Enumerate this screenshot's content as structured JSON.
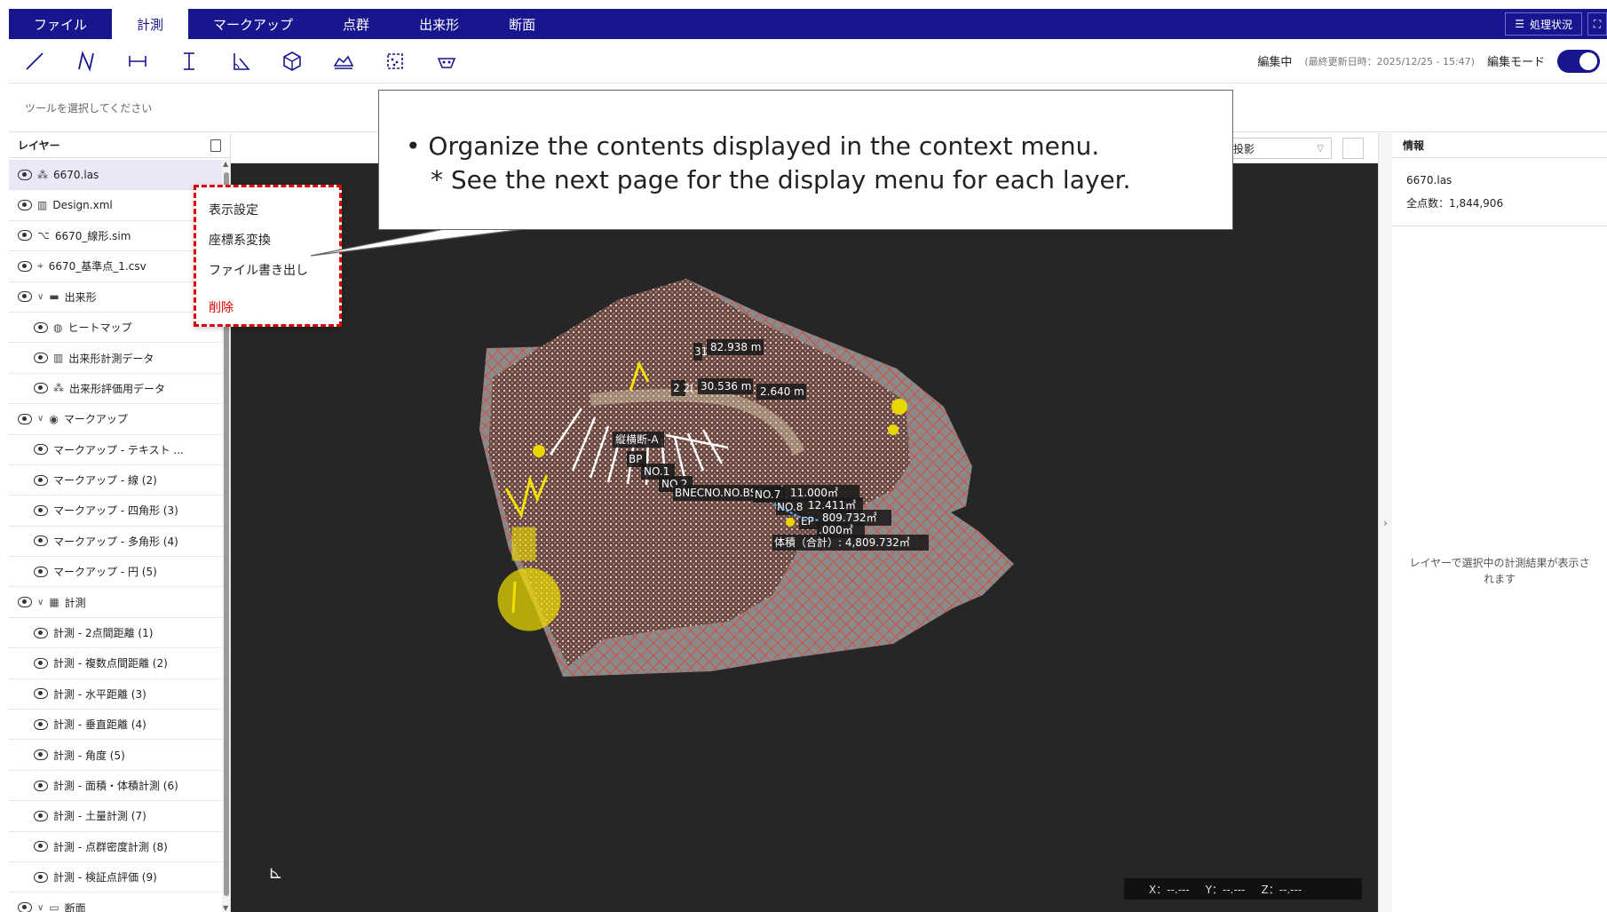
{
  "menubar": {
    "items": [
      {
        "label": "ファイル",
        "active": false
      },
      {
        "label": "計測",
        "active": true
      },
      {
        "label": "マークアップ",
        "active": false
      },
      {
        "label": "点群",
        "active": false
      },
      {
        "label": "出来形",
        "active": false
      },
      {
        "label": "断面",
        "active": false
      }
    ],
    "status_label": "処理状況"
  },
  "toolbar": {
    "tools": [
      "line-tool-icon",
      "polyline-tool-icon",
      "horizontal-distance-icon",
      "vertical-distance-icon",
      "angle-tool-icon",
      "volume-tool-icon",
      "earthwork-tool-icon",
      "density-tool-icon",
      "inspection-tool-icon"
    ],
    "edit_status": "編集中",
    "last_updated": "(最終更新日時：2025/12/25 - 15:47)",
    "edit_mode_label": "編集モード"
  },
  "hint": "ツールを選択してください",
  "layers_panel": {
    "title": "レイヤー",
    "items": [
      {
        "label": "6670.las",
        "icon": "⁂",
        "indent": false,
        "group": false,
        "selected": true
      },
      {
        "label": "Design.xml",
        "icon": "▥",
        "indent": false,
        "group": false,
        "selected": false
      },
      {
        "label": "6670_線形.sim",
        "icon": "⌥",
        "indent": false,
        "group": false,
        "selected": false
      },
      {
        "label": "6670_基準点_1.csv",
        "icon": "⌖",
        "indent": false,
        "group": false,
        "selected": false
      },
      {
        "label": "出来形",
        "icon": "▬",
        "indent": false,
        "group": true,
        "selected": false
      },
      {
        "label": "ヒートマップ",
        "icon": "◍",
        "indent": true,
        "group": false,
        "selected": false
      },
      {
        "label": "出来形計測データ",
        "icon": "▥",
        "indent": true,
        "group": false,
        "selected": false
      },
      {
        "label": "出来形評価用データ",
        "icon": "⁂",
        "indent": true,
        "group": false,
        "selected": false
      },
      {
        "label": "マークアップ",
        "icon": "◉",
        "indent": false,
        "group": true,
        "selected": false
      },
      {
        "label": "マークアップ - テキスト ...",
        "icon": "",
        "indent": true,
        "group": false,
        "selected": false
      },
      {
        "label": "マークアップ - 線 (2)",
        "icon": "",
        "indent": true,
        "group": false,
        "selected": false
      },
      {
        "label": "マークアップ - 四角形 (3)",
        "icon": "",
        "indent": true,
        "group": false,
        "selected": false
      },
      {
        "label": "マークアップ - 多角形 (4)",
        "icon": "",
        "indent": true,
        "group": false,
        "selected": false
      },
      {
        "label": "マークアップ - 円 (5)",
        "icon": "",
        "indent": true,
        "group": false,
        "selected": false
      },
      {
        "label": "計測",
        "icon": "▦",
        "indent": false,
        "group": true,
        "selected": false
      },
      {
        "label": "計測 - 2点間距離 (1)",
        "icon": "",
        "indent": true,
        "group": false,
        "selected": false
      },
      {
        "label": "計測 - 複数点間距離 (2)",
        "icon": "",
        "indent": true,
        "group": false,
        "selected": false
      },
      {
        "label": "計測 - 水平距離 (3)",
        "icon": "",
        "indent": true,
        "group": false,
        "selected": false
      },
      {
        "label": "計測 - 垂直距離 (4)",
        "icon": "",
        "indent": true,
        "group": false,
        "selected": false
      },
      {
        "label": "計測 - 角度 (5)",
        "icon": "",
        "indent": true,
        "group": false,
        "selected": false
      },
      {
        "label": "計測 - 面積・体積計測 (6)",
        "icon": "",
        "indent": true,
        "group": false,
        "selected": false
      },
      {
        "label": "計測 - 土量計測 (7)",
        "icon": "",
        "indent": true,
        "group": false,
        "selected": false
      },
      {
        "label": "計測 - 点群密度計測 (8)",
        "icon": "",
        "indent": true,
        "group": false,
        "selected": false
      },
      {
        "label": "計測 - 検証点評価 (9)",
        "icon": "",
        "indent": true,
        "group": false,
        "selected": false
      },
      {
        "label": "断面",
        "icon": "▭",
        "indent": false,
        "group": true,
        "selected": false
      }
    ]
  },
  "context_menu": {
    "items": [
      {
        "label": "表示設定",
        "danger": false
      },
      {
        "label": "座標系変換",
        "danger": false
      },
      {
        "label": "ファイル書き出し",
        "danger": false
      },
      {
        "label": "削除",
        "danger": true
      }
    ]
  },
  "callout": {
    "line1": "•  Organize the contents displayed in the context menu.",
    "line2": "* See the next page for the display menu for each layer."
  },
  "viewport": {
    "projection": "投影",
    "coords": {
      "x": "X：--.---",
      "y": "Y：--.---",
      "z": "Z：--.---"
    },
    "labels": [
      {
        "text": "82.938 m"
      },
      {
        "text": "30.536 m"
      },
      {
        "text": "2.640 m"
      },
      {
        "text": "縦横断-A"
      },
      {
        "text": "BP"
      },
      {
        "text": "NO.1"
      },
      {
        "text": "NO.2"
      },
      {
        "text": "NO.7"
      },
      {
        "text": "NO.8"
      },
      {
        "text": "EP"
      },
      {
        "text": "11.000㎡"
      },
      {
        "text": "12.411㎡"
      },
      {
        "text": "809.732㎡"
      },
      {
        "text": ".000㎡"
      },
      {
        "text": "体積（合計）: 4,809.732㎥"
      },
      {
        "text": "31"
      },
      {
        "text": "2 2("
      },
      {
        "text": "BNECNO.NO.BSE"
      }
    ]
  },
  "info_panel": {
    "title": "情報",
    "file_name": "6670.las",
    "total_points": "全点数：1,844,906",
    "empty_message": "レイヤーで選択中の計測結果が表示されます"
  },
  "colors": {
    "menu_bg": "#17168f",
    "danger": "#e00000",
    "mesh_red": "#e8473a"
  }
}
